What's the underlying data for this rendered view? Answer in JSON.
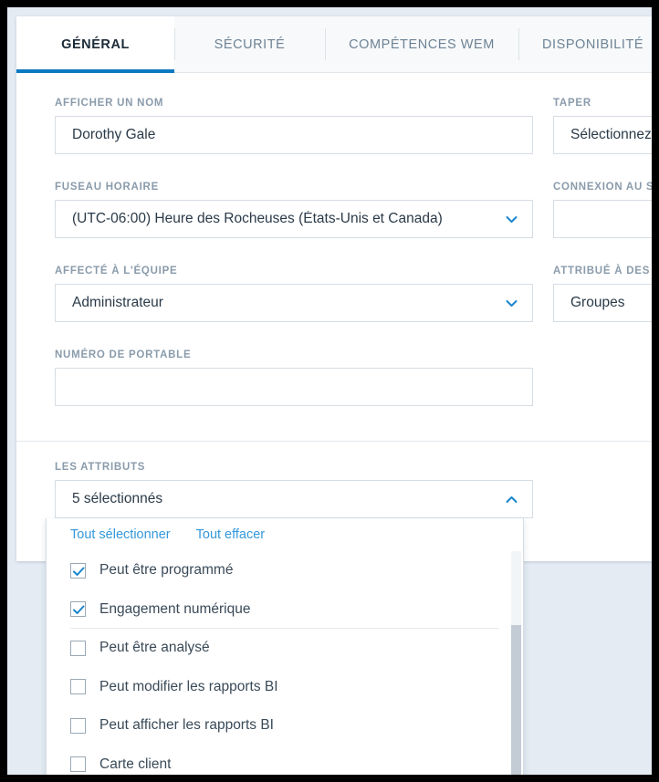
{
  "tabs": [
    {
      "label": "GÉNÉRAL",
      "active": true
    },
    {
      "label": "SÉCURITÉ",
      "active": false
    },
    {
      "label": "COMPÉTENCES WEM",
      "active": false
    },
    {
      "label": "DISPONIBILITÉ",
      "active": false
    }
  ],
  "fields": {
    "display_name": {
      "label": "AFFICHER UN NOM",
      "value": "Dorothy Gale",
      "type": "text"
    },
    "timezone": {
      "label": "FUSEAU HORAIRE",
      "value": "(UTC-06:00) Heure des Rocheuses (États-Unis et Canada)",
      "type": "select"
    },
    "team": {
      "label": "AFFECTÉ À L'ÉQUIPE",
      "value": "Administrateur",
      "type": "select"
    },
    "mobile": {
      "label": "NUMÉRO DE PORTABLE",
      "value": "",
      "type": "text"
    },
    "user_type": {
      "label": "TAPER",
      "value": "Sélectionnez",
      "type": "select"
    },
    "connection": {
      "label": "CONNEXION AU S",
      "value": "",
      "type": "text"
    },
    "groups": {
      "label": "ATTRIBUÉ À DES G",
      "value": "Groupes",
      "type": "select"
    }
  },
  "attributes": {
    "label": "LES ATTRIBUTS",
    "summary": "5 sélectionnés",
    "expanded": true,
    "select_all_label": "Tout sélectionner",
    "clear_all_label": "Tout effacer",
    "options": [
      {
        "label": "Peut être programmé",
        "checked": true
      },
      {
        "label": "Engagement numérique",
        "checked": true
      },
      {
        "label": "Peut être analysé",
        "checked": false
      },
      {
        "label": "Peut modifier les rapports BI",
        "checked": false
      },
      {
        "label": "Peut afficher les rapports BI",
        "checked": false
      },
      {
        "label": "Carte client",
        "checked": false
      }
    ]
  },
  "colors": {
    "accent": "#0b79c1",
    "link": "#3498db",
    "label": "#8a9bab",
    "border": "#d6dde3",
    "app_background": "#e4ebf3",
    "frame": "#000000"
  }
}
